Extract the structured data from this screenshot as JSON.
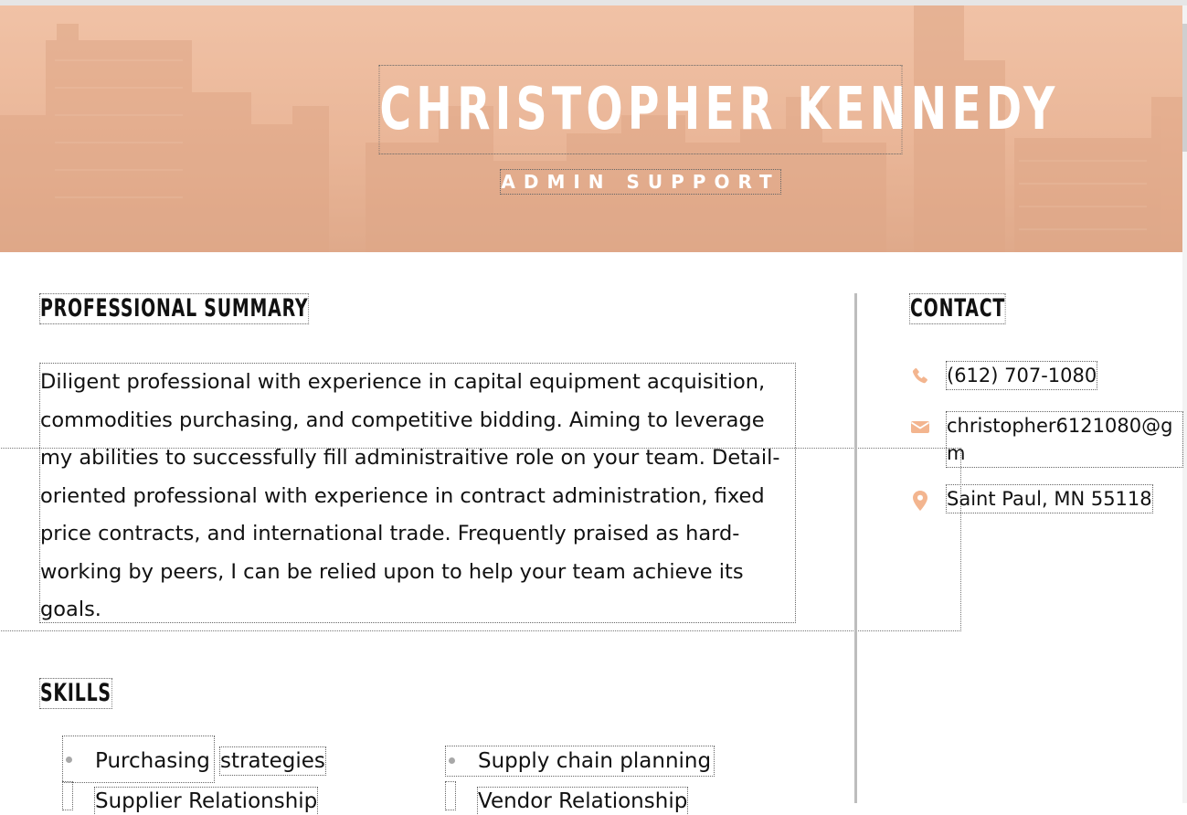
{
  "header": {
    "name": "CHRISTOPHER KENNEDY",
    "title": "ADMIN SUPPORT"
  },
  "sections": {
    "summary_heading": "PROFESSIONAL SUMMARY",
    "skills_heading": "SKILLS",
    "contact_heading": "CONTACT"
  },
  "summary": {
    "text": "Diligent professional with experience in capital equipment acquisition, commodities purchasing, and competitive bidding. Aiming to leverage my abilities to successfully fill administraitive role on your team. Detail-oriented professional with experience in contract administration, fixed price contracts, and international trade. Frequently praised as hard-working by peers, I can be relied upon to help your team achieve its goals."
  },
  "contact": {
    "phone": "(612) 707-1080",
    "email": "christopher6121080@gm",
    "location": "Saint Paul, MN 55118",
    "phone_icon": "phone-icon",
    "email_icon": "envelope-icon",
    "location_icon": "map-pin-icon"
  },
  "skills": {
    "col1_item1_a": "Purchasing",
    "col1_item1_b": "strategies",
    "col2_item1": "Supply chain planning",
    "col1_item2": "Supplier Relationship",
    "col2_item2": "Vendor Relationship"
  },
  "colors": {
    "accent": "#f3b58f",
    "banner_tint": "#e7b293",
    "divider": "#bdbdbd"
  }
}
